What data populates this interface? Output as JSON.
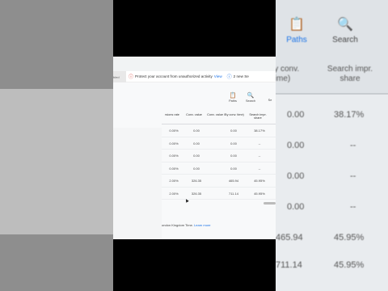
{
  "alert": {
    "message": "Protect your account from unauthorized activity",
    "link": "View",
    "info": "2 new Se",
    "left_text": "bled"
  },
  "toolbar": {
    "paths": "Paths",
    "search": "Search",
    "more": "Se"
  },
  "table": {
    "headers": [
      "rsions rate",
      "Conv. value",
      "Conv. value /By conv. time)",
      "Search impr. share"
    ],
    "rows": [
      [
        "0.00%",
        "0.00",
        "0.00",
        "38.17%"
      ],
      [
        "0.00%",
        "0.00",
        "0.00",
        "--"
      ],
      [
        "0.00%",
        "0.00",
        "0.00",
        "--"
      ],
      [
        "0.00%",
        "0.00",
        "0.00",
        "--"
      ],
      [
        "2.00%",
        "326.35",
        "465.94",
        "45.95%"
      ],
      [
        "2.00%",
        "326.35",
        "711.14",
        "45.95%"
      ]
    ]
  },
  "footer": {
    "text": "ondon Kingdom Time.",
    "link": "Learn more"
  },
  "right_blur": {
    "tab_paths": "Paths",
    "tab_search": "Search",
    "col_conv": "ly conv. time)",
    "col_search": "Search impr. share",
    "values": [
      "0.00",
      "38.17%",
      "0.00",
      "--",
      "0.00",
      "--",
      "0.00",
      "--",
      "465.94",
      "45.95%",
      "711.14",
      "45.95%"
    ]
  }
}
